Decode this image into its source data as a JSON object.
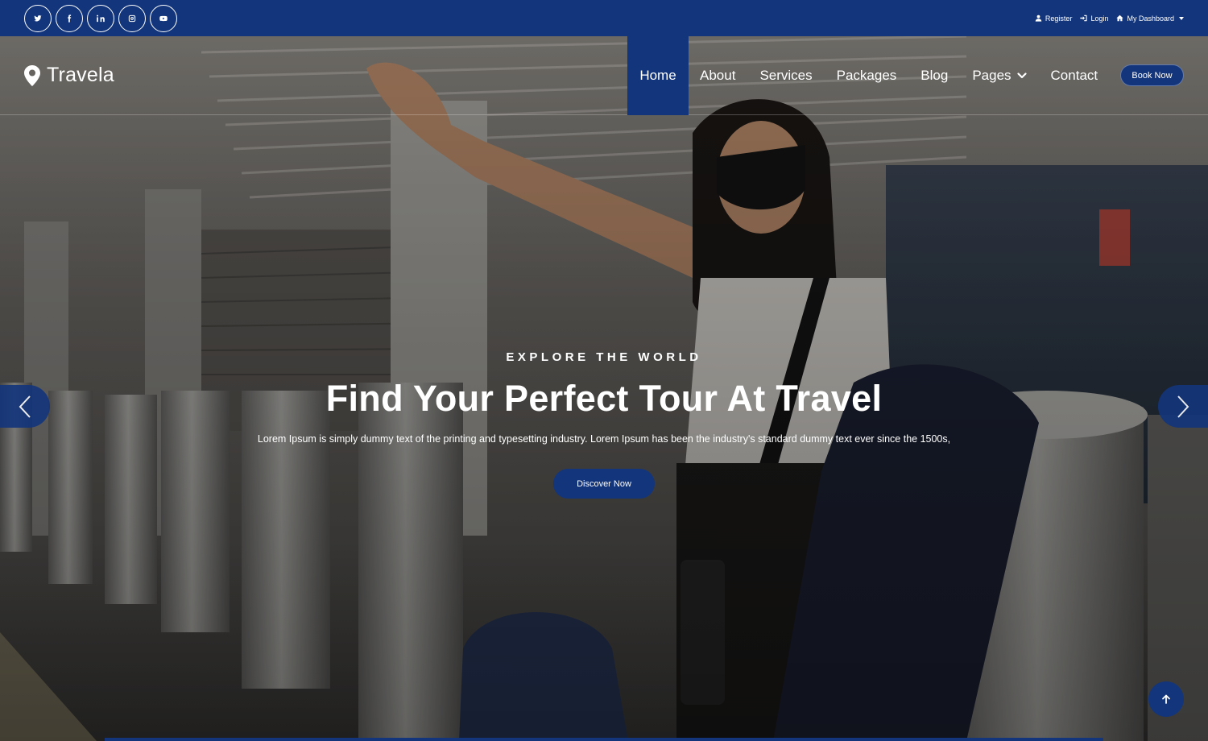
{
  "topbar": {
    "socials": [
      {
        "name": "twitter-icon",
        "glyph": "twitter"
      },
      {
        "name": "facebook-icon",
        "glyph": "f"
      },
      {
        "name": "linkedin-icon",
        "glyph": "in"
      },
      {
        "name": "instagram-icon",
        "glyph": "instagram"
      },
      {
        "name": "youtube-icon",
        "glyph": "youtube"
      }
    ],
    "register_label": "Register",
    "login_label": "Login",
    "dashboard_label": "My Dashboard"
  },
  "navbar": {
    "brand": "Travela",
    "items": [
      {
        "label": "Home",
        "active": true
      },
      {
        "label": "About"
      },
      {
        "label": "Services"
      },
      {
        "label": "Packages"
      },
      {
        "label": "Blog"
      },
      {
        "label": "Pages",
        "dropdown": true
      },
      {
        "label": "Contact"
      }
    ],
    "book_label": "Book Now"
  },
  "hero": {
    "eyebrow": "EXPLORE THE WORLD",
    "headline": "Find Your Perfect Tour At Travel",
    "subtext": "Lorem Ipsum is simply dummy text of the printing and typesetting industry. Lorem Ipsum has been the industry's standard dummy text ever since the 1500s,",
    "cta_label": "Discover Now"
  },
  "colors": {
    "primary": "#13357b"
  }
}
